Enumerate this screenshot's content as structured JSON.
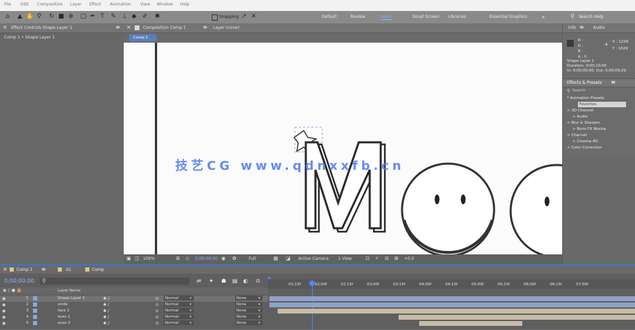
{
  "menubar": {
    "items": [
      "File",
      "Edit",
      "Composition",
      "Layer",
      "Effect",
      "Animation",
      "View",
      "Window",
      "Help"
    ]
  },
  "toolbar": {
    "snapping_label": "Snapping",
    "workspaces": [
      {
        "label": "Default",
        "active": false
      },
      {
        "label": "Review",
        "active": false
      },
      {
        "label": "Learn",
        "active": true
      },
      {
        "label": "Small Screen",
        "active": false
      },
      {
        "label": "Libraries",
        "active": false
      },
      {
        "label": "Essential Graphics",
        "active": false
      }
    ],
    "search_label": "Search Help"
  },
  "project": {
    "tab": "Effect Controls Shape Layer 1",
    "subtitle": "Comp 1 • Shape Layer 1"
  },
  "viewer": {
    "tab": "Composition Comp 1",
    "layer_tab": "Layer (none)",
    "comp_chip": "Comp 1",
    "viewer_bar": {
      "zoom": "100%",
      "timecode": "0;00;00;00",
      "resolution": "Full",
      "camera": "Active Camera",
      "views": "1 View",
      "offset": "+0.0"
    }
  },
  "right": {
    "tabs": [
      "Info",
      "Audio"
    ],
    "info_lines": [
      "R :",
      "G :",
      "B :",
      "A : 0"
    ],
    "info_xy": [
      "X : 1228",
      "Y : 1029"
    ],
    "shape_lines": [
      "Shape Layer 1",
      "Duration: 0;00;10;00",
      "In: 0;00;00;00, Out: 0;00;09;29"
    ],
    "effects_tab": "Effects & Presets",
    "search_placeholder": "Search",
    "effect_items": [
      "* Animation Presets",
      "Favorites",
      "> 3D Channel",
      "> Audio",
      "> Blur & Sharpen",
      "> Boris FX Mocha",
      "> Channel",
      "> Cinema 4D",
      "> Color Correction"
    ]
  },
  "timeline": {
    "tab": "Comp 1",
    "tab2": "01",
    "tab3": "Comp",
    "timecode": "0;00;00;00",
    "column_header": "Layer Name",
    "layers": [
      {
        "num": "1",
        "name": "Shape Layer 1",
        "mode": "Normal",
        "parent": "None"
      },
      {
        "num": "2",
        "name": "smile",
        "mode": "Normal",
        "parent": "None"
      },
      {
        "num": "3",
        "name": "face 1",
        "mode": "Normal",
        "parent": "None"
      },
      {
        "num": "4",
        "name": "eyes 1",
        "mode": "Normal",
        "parent": "None"
      },
      {
        "num": "5",
        "name": "eyes 3",
        "mode": "Normal",
        "parent": "None"
      }
    ],
    "ticks": [
      "01;15f",
      "02;00f",
      "02;15f",
      "03;00f",
      "03;15f",
      "04;00f",
      "04;15f",
      "05;00f",
      "05;15f",
      "06;00f",
      "06;15f",
      "07;00f"
    ]
  },
  "watermark": "技艺CG www.qdnxxfb.cn",
  "colors": {
    "accent": "#7fb2ff",
    "timeline_border": "#3a76c7",
    "bar_blue": "#8fa3c9",
    "bar_tan": "#c9bba6",
    "label_blue": "#8ca6d8"
  }
}
